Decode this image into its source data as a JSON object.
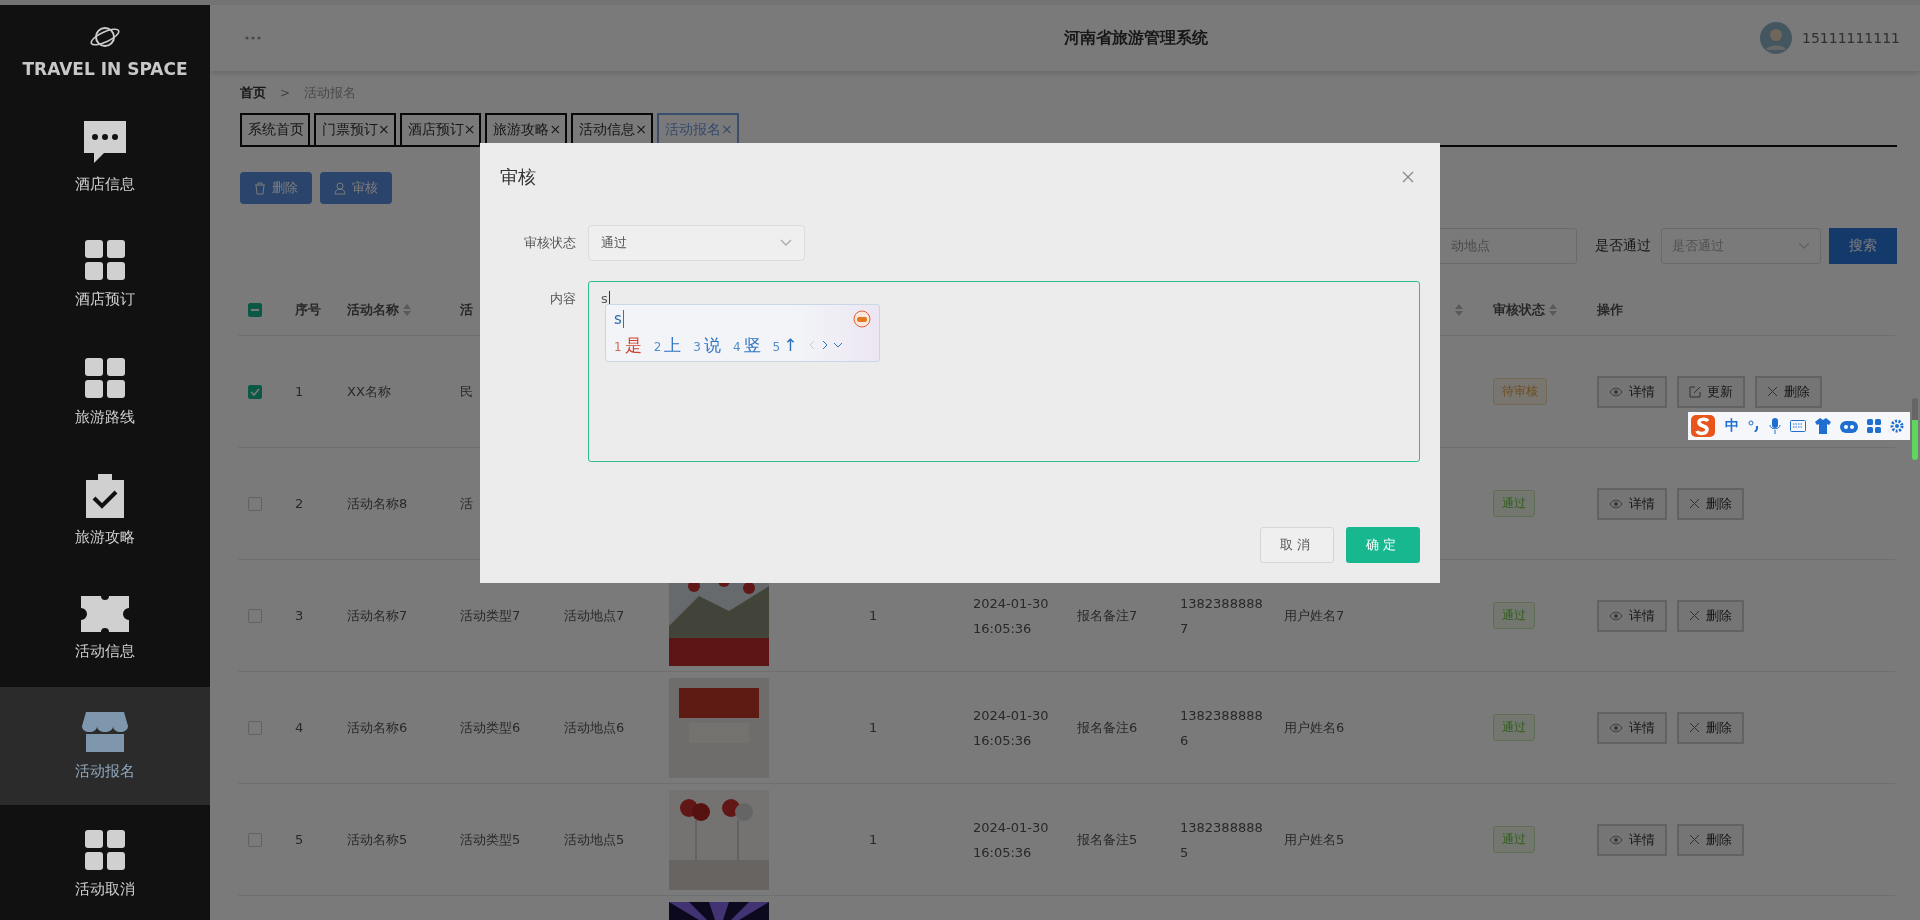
{
  "sidebar": {
    "logo": "TRAVEL IN SPACE",
    "items": [
      {
        "label": "酒店信息",
        "kind": "chat",
        "selected": false
      },
      {
        "label": "酒店预订",
        "kind": "grid",
        "selected": false
      },
      {
        "label": "旅游路线",
        "kind": "grid",
        "selected": false
      },
      {
        "label": "旅游攻略",
        "kind": "clipboard",
        "selected": false
      },
      {
        "label": "活动信息",
        "kind": "ticket",
        "selected": false
      },
      {
        "label": "活动报名",
        "kind": "shop",
        "selected": true
      },
      {
        "label": "活动取消",
        "kind": "grid",
        "selected": false
      }
    ]
  },
  "header": {
    "title": "河南省旅游管理系统",
    "user": "15111111111"
  },
  "breadcrumb": {
    "items": [
      "首页",
      "活动报名"
    ],
    "separator": ">"
  },
  "tabs": [
    {
      "label": "系统首页",
      "selected": false
    },
    {
      "label": "门票预订",
      "close": "×",
      "selected": false
    },
    {
      "label": "酒店预订",
      "close": "×",
      "selected": false
    },
    {
      "label": "旅游攻略",
      "close": "×",
      "selected": false
    },
    {
      "label": "活动信息",
      "close": "×",
      "selected": false
    },
    {
      "label": "活动报名",
      "close": "×",
      "selected": true
    }
  ],
  "toolbar": [
    {
      "label": "删除",
      "kind": "delete"
    },
    {
      "label": "审核",
      "kind": "audit"
    }
  ],
  "search": {
    "place_placeholder": "动地点",
    "pass_label": "是否通过",
    "pass_placeholder": "是否通过",
    "button": "搜索"
  },
  "table": {
    "header": {
      "select_all_indeterminate": true,
      "index": "序号",
      "name": {
        "label": "活动名称",
        "sortable": true
      },
      "type": "活",
      "extra": {
        "sortable": true
      },
      "status": {
        "label": "审核状态",
        "sortable": true
      },
      "actions": "操作"
    },
    "rows": [
      {
        "checked": true,
        "index": "1",
        "name": "XX名称",
        "type": "民",
        "status": {
          "label": "待审核",
          "kind": "pending"
        },
        "actions": [
          {
            "label": "详情",
            "kind": "view"
          },
          {
            "label": "更新",
            "kind": "edit"
          },
          {
            "label": "删除",
            "kind": "delete"
          }
        ]
      },
      {
        "checked": false,
        "index": "2",
        "name": "活动名称8",
        "type": "活",
        "status": {
          "label": "通过",
          "kind": "passed"
        },
        "actions": [
          {
            "label": "详情",
            "kind": "view"
          },
          {
            "label": "删除",
            "kind": "delete"
          }
        ]
      },
      {
        "checked": false,
        "index": "3",
        "name": "活动名称7",
        "type": "活动类型7",
        "place": "活动地点7",
        "picture": {
          "kind": "picture"
        },
        "quantity": "1",
        "time": "2024-01-30 16:05:36",
        "remark": "报名备注7",
        "phone": "13823888887",
        "user": "用户姓名7",
        "status": {
          "label": "通过",
          "kind": "passed"
        },
        "actions": [
          {
            "label": "详情",
            "kind": "view"
          },
          {
            "label": "删除",
            "kind": "delete"
          }
        ]
      },
      {
        "checked": false,
        "index": "4",
        "name": "活动名称6",
        "type": "活动类型6",
        "place": "活动地点6",
        "picture": {
          "kind": "picture"
        },
        "quantity": "1",
        "time": "2024-01-30 16:05:36",
        "remark": "报名备注6",
        "phone": "13823888886",
        "user": "用户姓名6",
        "status": {
          "label": "通过",
          "kind": "passed"
        },
        "actions": [
          {
            "label": "详情",
            "kind": "view"
          },
          {
            "label": "删除",
            "kind": "delete"
          }
        ]
      },
      {
        "checked": false,
        "index": "5",
        "name": "活动名称5",
        "type": "活动类型5",
        "place": "活动地点5",
        "picture": {
          "kind": "picture"
        },
        "quantity": "1",
        "time": "2024-01-30 16:05:36",
        "remark": "报名备注5",
        "phone": "13823888885",
        "user": "用户姓名5",
        "status": {
          "label": "通过",
          "kind": "passed"
        },
        "actions": [
          {
            "label": "详情",
            "kind": "view"
          },
          {
            "label": "删除",
            "kind": "delete"
          }
        ]
      },
      {
        "picture": {
          "kind": "picture"
        }
      }
    ]
  },
  "modal": {
    "title": "审核",
    "status_label": "审核状态",
    "status_value": "通过",
    "content_label": "内容",
    "content_value": "s",
    "ime": {
      "input": "s",
      "candidates": [
        {
          "num": "1",
          "text": "是",
          "selected": true
        },
        {
          "num": "2",
          "text": "上",
          "selected": false
        },
        {
          "num": "3",
          "text": "说",
          "selected": false
        },
        {
          "num": "4",
          "text": "竖",
          "selected": false
        },
        {
          "num": "5",
          "text": "↑",
          "selected": false
        }
      ]
    },
    "cancel": "取消",
    "confirm": "确定"
  },
  "ime_toolbar": {
    "mode": "中"
  }
}
